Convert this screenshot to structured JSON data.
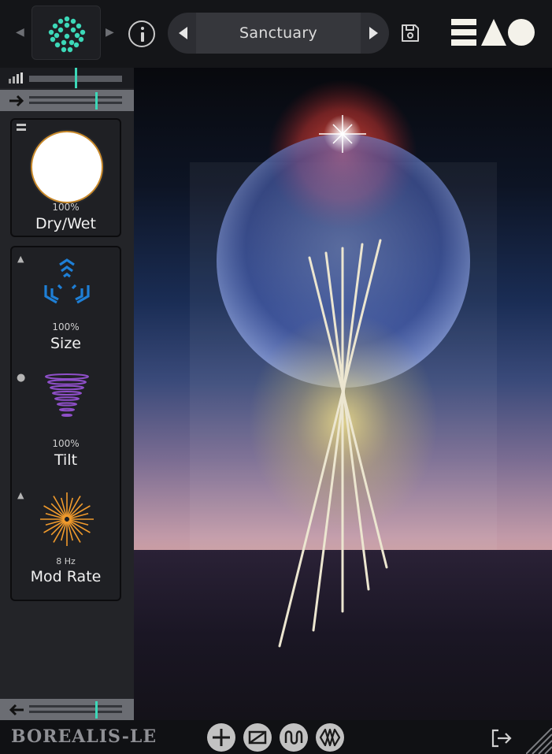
{
  "header": {
    "preset_name": "Sanctuary"
  },
  "params": {
    "drywet": {
      "value": "100%",
      "label": "Dry/Wet"
    },
    "size": {
      "value": "100%",
      "label": "Size"
    },
    "tilt": {
      "value": "100%",
      "label": "Tilt"
    },
    "modrate": {
      "value": "8 Hz",
      "label": "Mod Rate"
    }
  },
  "levels": {
    "input_meter_marker": 0.5,
    "input_gain_marker": 0.72,
    "output_gain_marker": 0.72
  },
  "footer": {
    "product_name": "BOREALIS-LE"
  },
  "colors": {
    "accent_teal": "#3cd8b8",
    "knob_ring": "#c98a2c",
    "size_icon": "#1e7fd6",
    "tilt_icon": "#8f4fc9",
    "modrate_icon": "#f09a2c"
  }
}
